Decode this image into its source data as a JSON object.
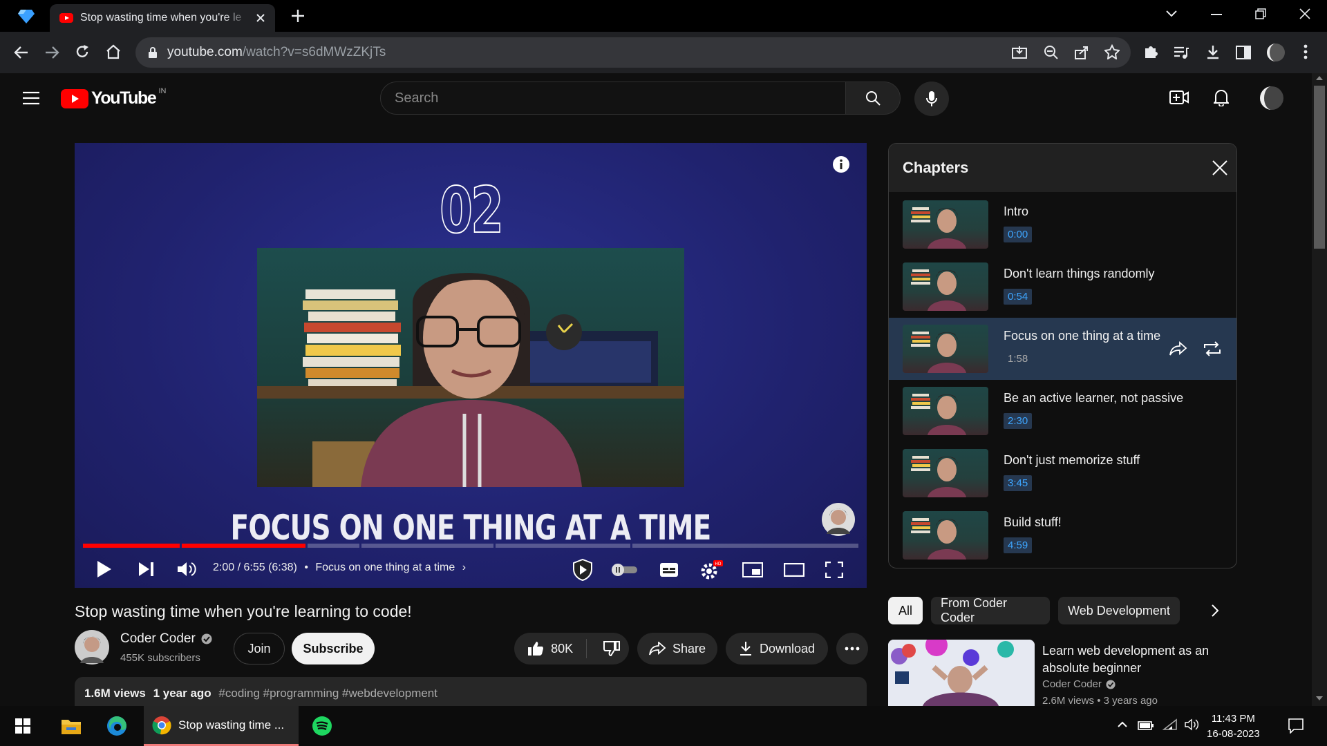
{
  "browser": {
    "tab_title": "Stop wasting time when you're le",
    "url_host": "youtube.com",
    "url_path": "/watch?v=s6dMWzZKjTs"
  },
  "youtube": {
    "logo_text": "YouTube",
    "region": "IN",
    "search_placeholder": "Search"
  },
  "video": {
    "number": "02",
    "caption": "FOCUS ON ONE THING AT A TIME",
    "time_display": "2:00 / 6:55 (6:38)",
    "chapter_label": "Focus on one thing at a time",
    "progress_fraction": 0.289,
    "title": "Stop wasting time when you're learning to code!"
  },
  "channel": {
    "name": "Coder Coder",
    "subscribers": "455K subscribers",
    "join_label": "Join",
    "subscribe_label": "Subscribe"
  },
  "actions": {
    "likes": "80K",
    "share": "Share",
    "download": "Download"
  },
  "description": {
    "views": "1.6M views",
    "age": "1 year ago",
    "tags": "#coding #programming #webdevelopment"
  },
  "chapters": {
    "heading": "Chapters",
    "items": [
      {
        "title": "Intro",
        "time": "0:00"
      },
      {
        "title": "Don't learn things randomly",
        "time": "0:54"
      },
      {
        "title": "Focus on one thing at a time",
        "time": "1:58"
      },
      {
        "title": "Be an active learner, not passive",
        "time": "2:30"
      },
      {
        "title": "Don't just memorize stuff",
        "time": "3:45"
      },
      {
        "title": "Build stuff!",
        "time": "4:59"
      }
    ]
  },
  "chips": [
    "All",
    "From Coder Coder",
    "Web Development"
  ],
  "recommendation": {
    "title_line1": "Learn web development as an",
    "title_line2": "absolute beginner",
    "channel": "Coder Coder",
    "meta": "2.6M views • 3 years ago"
  },
  "taskbar": {
    "running_app": "Stop wasting time ...",
    "time": "11:43 PM",
    "date": "16-08-2023"
  },
  "colors": {
    "accent_red": "#ff0000",
    "chapter_active_bg": "#263850",
    "chapter_time": "#3ea6ff"
  }
}
